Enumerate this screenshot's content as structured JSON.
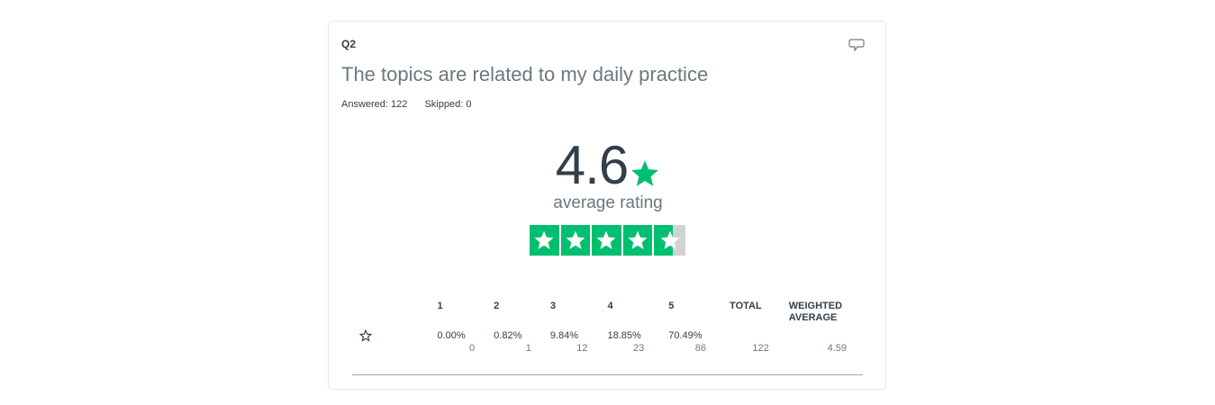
{
  "question": {
    "number": "Q2",
    "title": "The topics are related to my daily practice",
    "answered": "Answered: 122",
    "skipped": "Skipped: 0"
  },
  "rating": {
    "average": "4.6",
    "average_label": "average rating",
    "average_value": 4.59,
    "max_stars": 5,
    "accent_color": "#00bf6f"
  },
  "table": {
    "headers": [
      "1",
      "2",
      "3",
      "4",
      "5",
      "TOTAL",
      "WEIGHTED AVERAGE"
    ],
    "row": {
      "icon": "star-outline-icon",
      "percents": [
        "0.00%",
        "0.82%",
        "9.84%",
        "18.85%",
        "70.49%"
      ],
      "counts": [
        "0",
        "1",
        "12",
        "23",
        "86"
      ],
      "total": "122",
      "weighted_average": "4.59"
    }
  }
}
